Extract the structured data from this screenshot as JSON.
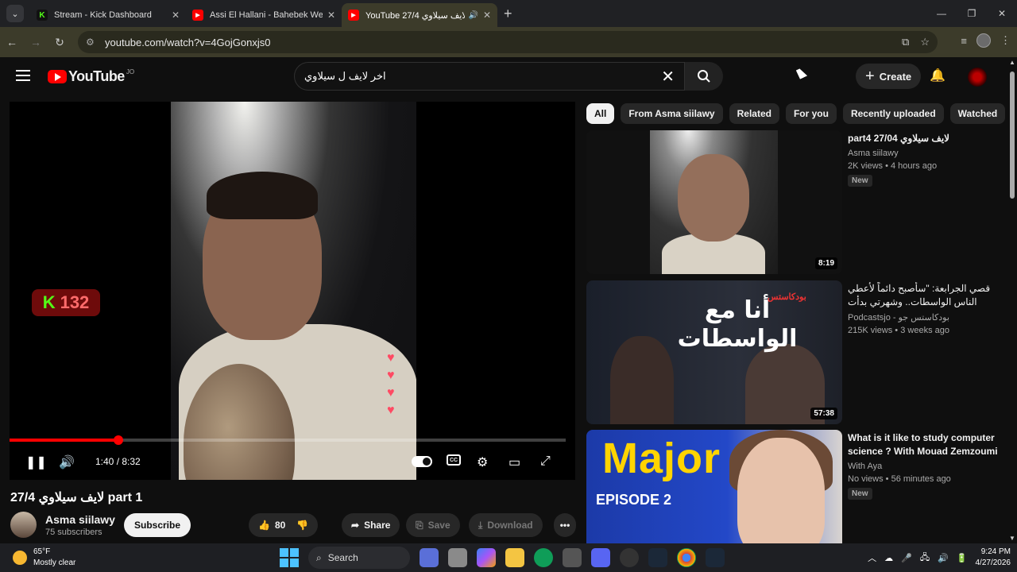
{
  "browser": {
    "tabs": [
      {
        "title": "Stream - Kick Dashboard",
        "favicon": "kick-icon",
        "active": false
      },
      {
        "title": "Assi El Hallani - Bahebek We Bg",
        "favicon": "youtube-icon",
        "active": false
      },
      {
        "title": "YouTube 27/4 لايف سيلاوي",
        "favicon": "youtube-icon",
        "active": true
      }
    ],
    "url": "youtube.com/watch?v=4GojGonxjs0",
    "accent": "#3c3b2a"
  },
  "youtube": {
    "logo_text": "YouTube",
    "country_code": "JO",
    "search_query": "اخر لايف ل سيلاوي",
    "create_label": "Create"
  },
  "player": {
    "time_current": "1:40",
    "time_separator": " / ",
    "time_total": "8:32",
    "progress_fraction": 0.195,
    "overlay_kick_count": "132"
  },
  "video": {
    "title": "27/4 لايف سيلاوي part 1",
    "channel": "Asma siilawy",
    "subscribers": "75 subscribers",
    "subscribe_label": "Subscribe",
    "likes": "80",
    "share_label": "Share",
    "save_label": "Save",
    "download_label": "Download"
  },
  "chips": [
    "All",
    "From Asma siilawy",
    "Related",
    "For you",
    "Recently uploaded",
    "Watched"
  ],
  "recommendations": [
    {
      "title": "part4 27/04 لايف سيلاوي",
      "channel": "Asma siilawy",
      "views": "2K views • 4 hours ago",
      "badge": "New",
      "duration": "8:19"
    },
    {
      "title": "قصي الجرابعة: \"سأصبح دائماً لأعطي الناس الواسطات.. وشهرتي بدأت بصدفة\" | ما وراء ...",
      "channel": "Podcastsjo - بودكاستس جو",
      "views": "215K views • 3 weeks ago",
      "badge": "",
      "duration": "57:38",
      "thumb_text": "أنا مع الواسطات",
      "thumb_logo": "بودكاستس"
    },
    {
      "title": "What is it like to study computer science ? With Mouad Zemzoumi ...",
      "channel": "With Aya",
      "views": "No views • 56 minutes ago",
      "badge": "New",
      "duration": "",
      "thumb_text": "Major",
      "thumb_sub": "EPISODE 2"
    }
  ],
  "taskbar": {
    "temperature": "65°F",
    "condition": "Mostly clear",
    "search_label": "Search",
    "time": "9:24 PM",
    "date": "4/27/2026"
  }
}
